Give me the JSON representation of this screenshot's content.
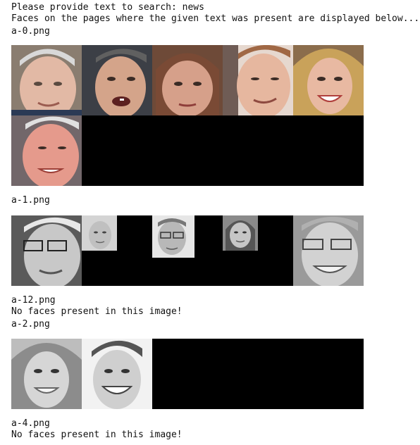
{
  "console": {
    "prompt_line": "Please provide text to search: news",
    "info_line": "Faces on the pages where the given text was present are displayed below...",
    "results": [
      {
        "file": "a-0.png"
      },
      {
        "file": "a-1.png"
      },
      {
        "file": "a-12.png",
        "message": "No faces present in this image!"
      },
      {
        "file": "a-2.png"
      },
      {
        "file": "a-4.png",
        "message": "No faces present in this image!"
      }
    ]
  },
  "colors": {
    "background": "#ffffff",
    "text": "#111111",
    "grid_fill": "#000000"
  },
  "faces": {
    "a0": [
      "face-older-man-smile",
      "face-man-talking",
      "face-woman-dark-hair",
      "face-man-smirk",
      "face-woman-blonde-smile",
      "face-man-red-face"
    ],
    "a1": [
      "face-man-glasses-gray",
      "face-woman-small",
      "face-man-glasses-small",
      "face-woman-small-2",
      "face-older-man-glasses"
    ],
    "a2": [
      "face-woman-smiling-gray",
      "face-young-man-smiling"
    ]
  }
}
